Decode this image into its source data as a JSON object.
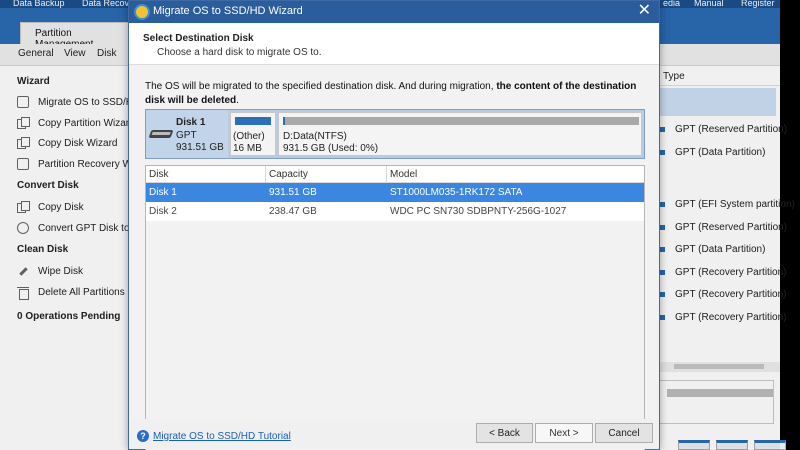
{
  "app": {
    "topbar": [
      "Data Backup",
      "Data Recov",
      "edia",
      "Manual",
      "Register"
    ],
    "active_tab": "Partition Management",
    "menu": [
      "General",
      "View",
      "Disk"
    ],
    "sidebar": {
      "wizard_heading": "Wizard",
      "wizard_items": [
        "Migrate OS to SSD/HD",
        "Copy Partition Wizard",
        "Copy Disk Wizard",
        "Partition Recovery Wiz"
      ],
      "convert_heading": "Convert Disk",
      "convert_items": [
        "Copy Disk",
        "Convert GPT Disk to M"
      ],
      "clean_heading": "Clean Disk",
      "clean_items": [
        "Wipe Disk",
        "Delete All Partitions"
      ],
      "pending": "0 Operations Pending"
    },
    "right_panel": {
      "header": "Type",
      "rows": [
        "GPT (Reserved Partition)",
        "GPT (Data Partition)",
        "GPT (EFI System partition)",
        "GPT (Reserved Partition)",
        "GPT (Data Partition)",
        "GPT (Recovery Partition)",
        "GPT (Recovery Partition)",
        "GPT (Recovery Partition)"
      ]
    }
  },
  "dialog": {
    "title": "Migrate OS to SSD/HD Wizard",
    "close": "✕",
    "header_title": "Select Destination Disk",
    "header_subtitle": "Choose a hard disk to migrate OS to.",
    "info_normal": "The OS will be migrated to the specified destination disk. And during migration, ",
    "info_bold": "the content of the destination disk will be deleted",
    "info_end": ".",
    "disk_map": {
      "disk_name": "Disk 1",
      "disk_scheme": "GPT",
      "disk_capacity": "931.51 GB",
      "part1_label": "(Other)",
      "part1_size": "16 MB",
      "part2_label": "D:Data(NTFS)",
      "part2_size": "931.5 GB (Used: 0%)"
    },
    "table": {
      "headers": [
        "Disk",
        "Capacity",
        "Model"
      ],
      "rows": [
        {
          "disk": "Disk 1",
          "capacity": "931.51 GB",
          "model": "ST1000LM035-1RK172 SATA"
        },
        {
          "disk": "Disk 2",
          "capacity": "238.47 GB",
          "model": "WDC PC SN730 SDBPNTY-256G-1027"
        }
      ]
    },
    "footer": {
      "help_link": "Migrate OS to SSD/HD Tutorial",
      "back": "< Back",
      "next": "Next >",
      "cancel": "Cancel"
    }
  },
  "colors": {
    "titlebar": "#2b5d9c",
    "selected_row": "#3a86e1",
    "disk_map_bg": "#b9cbe0",
    "partition_bar": "#2d6fb7"
  }
}
